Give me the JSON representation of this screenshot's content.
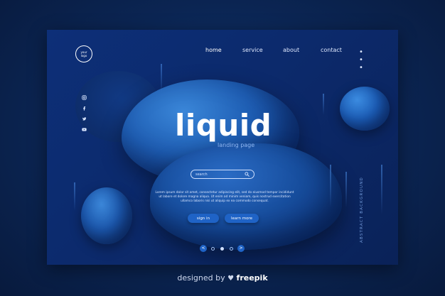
{
  "logo": {
    "line1": "your",
    "line2": "logo"
  },
  "nav": {
    "items": [
      {
        "label": "home"
      },
      {
        "label": "service"
      },
      {
        "label": "about"
      },
      {
        "label": "contact"
      }
    ],
    "more": "• • •"
  },
  "social": [
    {
      "icon": "instagram-icon"
    },
    {
      "icon": "facebook-icon"
    },
    {
      "icon": "twitter-icon"
    },
    {
      "icon": "youtube-icon"
    }
  ],
  "hero": {
    "title": "liquid",
    "subtitle": "landing page",
    "search_placeholder": "search",
    "body": "Lorem ipsum dolor sit amet, consectetur adipiscing elit, sed do eiusmod tempor incididunt ut labore et dolore magna aliqua. Ut enim ad minim veniam, quis nostrud exercitation ullamco laboris nisi ut aliquip ex ea commodo consequat.",
    "signin_label": "sign in",
    "learn_label": "learn more"
  },
  "pager": {
    "prev": "<",
    "next": ">"
  },
  "side_text": "ABSTRACT BACKGROUND",
  "credit": {
    "prefix": "designed by",
    "brand": "freepik"
  },
  "colors": {
    "accent": "#1f63c6",
    "background": "#0d2f78"
  }
}
